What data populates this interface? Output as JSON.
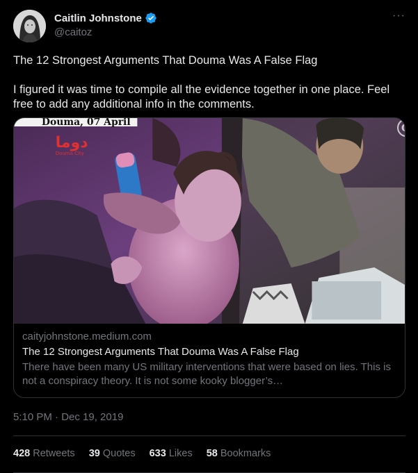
{
  "author": {
    "name": "Caitlin Johnstone",
    "handle": "@caitoz",
    "verified": true,
    "more_icon": "ellipsis-icon"
  },
  "tweet": {
    "line1": "The 12 Strongest Arguments That Douma Was A False Flag",
    "line2": "I figured it was time to compile all the evidence together in one place. Feel free to add any additional info in the comments."
  },
  "card": {
    "image_caption": "Douma, 07 April",
    "image_logo": "دوما",
    "image_logo_sub": "Douma City",
    "domain": "caityjohnstone.medium.com",
    "title": "The 12 Strongest Arguments That Douma Was A False Flag",
    "description": "There have been many US military interventions that were based on lies. This is not a conspiracy theory. It is not some kooky blogger’s…"
  },
  "timestamp": "5:10 PM · Dec 19, 2019",
  "stats": [
    {
      "count": "428",
      "label": "Retweets"
    },
    {
      "count": "39",
      "label": "Quotes"
    },
    {
      "count": "633",
      "label": "Likes"
    },
    {
      "count": "58",
      "label": "Bookmarks"
    }
  ],
  "colors": {
    "background": "#000000",
    "text": "#e7e9ea",
    "muted": "#71767b",
    "border": "#2f3336",
    "verified": "#1d9bf0"
  }
}
